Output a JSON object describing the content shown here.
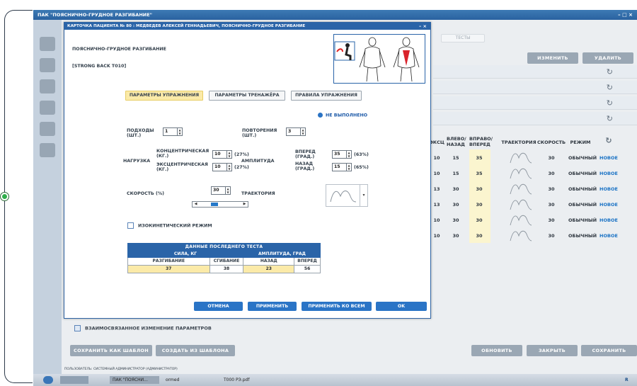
{
  "app": {
    "title": "ПАК \"ПОЯСНИЧНО-ГРУДНОЕ РАЗГИБАНИЕ\"",
    "window_controls": "– □ ×"
  },
  "background": {
    "tests_tab": "ТЕСТЫ",
    "buttons": {
      "edit": "ИЗМЕНИТЬ",
      "delete": "УДАЛИТЬ"
    },
    "table": {
      "headers": [
        "ЭКСЦ",
        "ВЛЕВО/ НАЗАД",
        "ВПРАВО/ ВПЕРЕД",
        "ТРАЕКТОРИЯ",
        "СКОРОСТЬ",
        "РЕЖИМ"
      ],
      "rows": [
        {
          "ecc": "10",
          "left": "15",
          "right": "35",
          "speed": "30",
          "mode": "ОБЫЧНЫЙ",
          "status": "НОВОЕ"
        },
        {
          "ecc": "10",
          "left": "15",
          "right": "35",
          "speed": "30",
          "mode": "ОБЫЧНЫЙ",
          "status": "НОВОЕ"
        },
        {
          "ecc": "13",
          "left": "30",
          "right": "30",
          "speed": "30",
          "mode": "ОБЫЧНЫЙ",
          "status": "НОВОЕ"
        },
        {
          "ecc": "13",
          "left": "30",
          "right": "30",
          "speed": "30",
          "mode": "ОБЫЧНЫЙ",
          "status": "НОВОЕ"
        },
        {
          "ecc": "10",
          "left": "30",
          "right": "30",
          "speed": "30",
          "mode": "ОБЫЧНЫЙ",
          "status": "НОВОЕ"
        },
        {
          "ecc": "10",
          "left": "30",
          "right": "30",
          "speed": "30",
          "mode": "ОБЫЧНЫЙ",
          "status": "НОВОЕ"
        }
      ]
    },
    "linked_change_label": "ВЗАИМОСВЯЗАННОЕ ИЗМЕНЕНИЕ ПАРАМЕТРОВ",
    "bottom_buttons": {
      "save_template": "СОХРАНИТЬ КАК ШАБЛОН",
      "create_from_template": "СОЗДАТЬ ИЗ ШАБЛОНА",
      "refresh": "ОБНОВИТЬ",
      "close": "ЗАКРЫТЬ",
      "save": "СОХРАНИТЬ"
    },
    "status_line": "ПОЛЬЗОВАТЕЛЬ: СИСТЕМНЫЙ АДМИНИСТРАТОР (АДМИНИСТРАТОР)"
  },
  "taskbar": {
    "items": [
      "ПАК \"ПОЯСНИ...",
      "ormed",
      "T000 РЭ.pdf"
    ],
    "tray_text": "R"
  },
  "dialog": {
    "title": "КАРТОЧКА ПАЦИЕНТА № 80 : МЕДВЕДЕВ АЛЕКСЕЙ ГЕННАДЬЕВИЧ, ПОЯСНИЧНО-ГРУДНОЕ РАЗГИБАНИЕ",
    "controls": "– ×",
    "exercise_name": "ПОЯСНИЧНО-ГРУДНОЕ РАЗГИБАНИЕ",
    "device": "[STRONG BACK T010]",
    "tabs": {
      "params": "ПАРАМЕТРЫ УПРАЖНЕНИЯ",
      "machine": "ПАРАМЕТРЫ ТРЕНАЖЁРА",
      "rules": "ПРАВИЛА УПРАЖНЕНИЯ"
    },
    "status": "НЕ ВЫПОЛНЕНО",
    "sets": {
      "label": "ПОДХОДЫ (ШТ.)",
      "value": "1"
    },
    "reps": {
      "label": "ПОВТОРЕНИЯ (ШТ.)",
      "value": "3"
    },
    "load": {
      "label": "НАГРУЗКА",
      "concentric_label": "КОНЦЕНТРИЧЕСКАЯ (КГ.)",
      "concentric_value": "10",
      "concentric_pct": "(27%)",
      "eccentric_label": "ЭКСЦЕНТРИЧЕСКАЯ (КГ.)",
      "eccentric_value": "10",
      "eccentric_pct": "(27%)"
    },
    "amplitude": {
      "label": "АМПЛИТУДА",
      "forward_label": "ВПЕРЕД (ГРАД.)",
      "forward_value": "35",
      "forward_pct": "(63%)",
      "back_label": "НАЗАД (ГРАД.)",
      "back_value": "15",
      "back_pct": "(65%)"
    },
    "speed": {
      "label": "СКОРОСТЬ (%)",
      "value": "30"
    },
    "trajectory_label": "ТРАЕКТОРИЯ",
    "isokinetic_label": "ИЗОКИНЕТИЧЕСКИЙ РЕЖИМ",
    "last_test": {
      "title": "ДАННЫЕ ПОСЛЕДНЕГО ТЕСТА",
      "group_force": "СИЛА, КГ",
      "group_amp": "АМПЛИТУДА, ГРАД",
      "cols": [
        "РАЗГИБАНИЕ",
        "СГИБАНИЕ",
        "НАЗАД",
        "ВПЕРЕД"
      ],
      "values": [
        "37",
        "38",
        "23",
        "56"
      ]
    },
    "buttons": {
      "cancel": "ОТМЕНА",
      "apply": "ПРИМЕНИТЬ",
      "apply_all": "ПРИМЕНИТЬ КО ВСЕМ",
      "ok": "OK"
    }
  }
}
